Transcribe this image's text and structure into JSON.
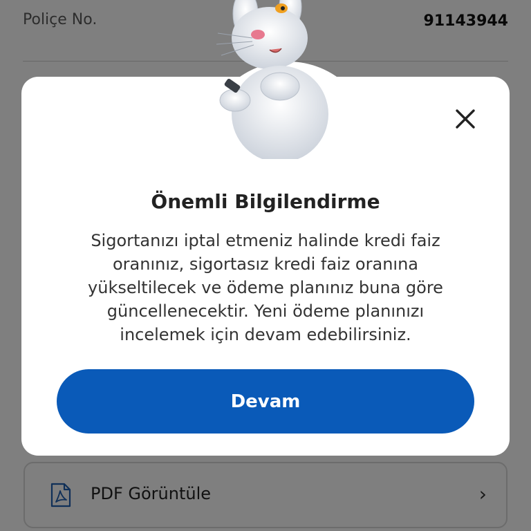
{
  "background": {
    "policy_label": "Poliçe No.",
    "policy_value": "91143944",
    "pdf_label": "PDF Görüntüle",
    "pdf_icon": "pdf-file-icon",
    "chevron_icon": "chevron-right-icon"
  },
  "modal": {
    "title": "Önemli Bilgilendirme",
    "body": "Sigortanızı iptal etmeniz halinde kredi faiz oranınız, sigortasız kredi faiz oranına yükseltilecek ve ödeme planınız buna göre güncellenecektir. Yeni ödeme planınızı incelemek için devam edebilirsiniz.",
    "primary_button": "Devam",
    "close_icon": "close-icon",
    "mascot": "rabbit-mascot-illustration"
  },
  "colors": {
    "primary": "#0a5ab8",
    "overlay": "rgba(0,0,0,0.5)"
  }
}
